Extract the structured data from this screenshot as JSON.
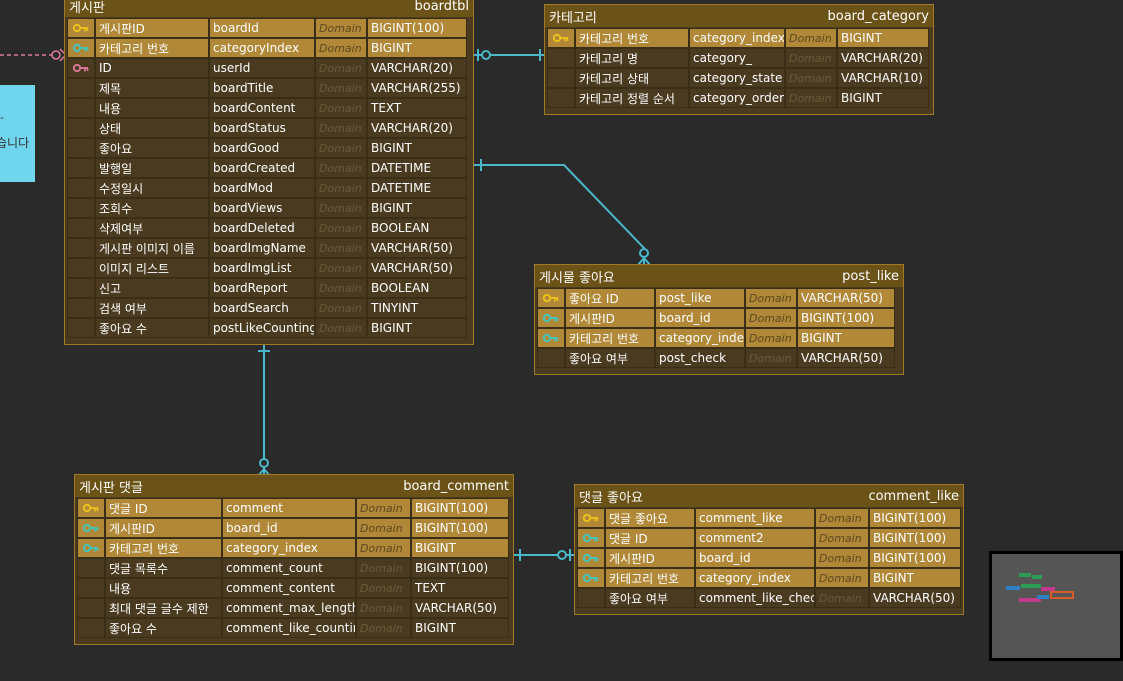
{
  "note": {
    "text_top": "-",
    "text_mid": "습니다"
  },
  "tables": {
    "boardtbl": {
      "title": "게시판",
      "name": "boardtbl",
      "rows": [
        {
          "label": "게시판ID",
          "column": "boardId",
          "domain": "Domain",
          "type": "BIGINT(100)",
          "key": "pk"
        },
        {
          "label": "카테고리 번호",
          "column": "categoryIndex",
          "domain": "Domain",
          "type": "BIGINT",
          "key": "pfk"
        },
        {
          "label": "ID",
          "column": "userId",
          "domain": "Domain",
          "type": "VARCHAR(20)",
          "key": "fk"
        },
        {
          "label": "제목",
          "column": "boardTitle",
          "domain": "Domain",
          "type": "VARCHAR(255)",
          "key": ""
        },
        {
          "label": "내용",
          "column": "boardContent",
          "domain": "Domain",
          "type": "TEXT",
          "key": ""
        },
        {
          "label": "상태",
          "column": "boardStatus",
          "domain": "Domain",
          "type": "VARCHAR(20)",
          "key": ""
        },
        {
          "label": "좋아요",
          "column": "boardGood",
          "domain": "Domain",
          "type": "BIGINT",
          "key": ""
        },
        {
          "label": "발행일",
          "column": "boardCreated",
          "domain": "Domain",
          "type": "DATETIME",
          "key": ""
        },
        {
          "label": "수정일시",
          "column": "boardMod",
          "domain": "Domain",
          "type": "DATETIME",
          "key": ""
        },
        {
          "label": "조회수",
          "column": "boardViews",
          "domain": "Domain",
          "type": "BIGINT",
          "key": ""
        },
        {
          "label": "삭제여부",
          "column": "boardDeleted",
          "domain": "Domain",
          "type": "BOOLEAN",
          "key": ""
        },
        {
          "label": "게시판 이미지 이름",
          "column": "boardImgName",
          "domain": "Domain",
          "type": "VARCHAR(50)",
          "key": ""
        },
        {
          "label": "이미지 리스트",
          "column": "boardImgList",
          "domain": "Domain",
          "type": "VARCHAR(50)",
          "key": ""
        },
        {
          "label": "신고",
          "column": "boardReport",
          "domain": "Domain",
          "type": "BOOLEAN",
          "key": ""
        },
        {
          "label": "검색 여부",
          "column": "boardSearch",
          "domain": "Domain",
          "type": "TINYINT",
          "key": ""
        },
        {
          "label": "좋아요 수",
          "column": "postLikeCounting",
          "domain": "Domain",
          "type": "BIGINT",
          "key": ""
        }
      ]
    },
    "board_category": {
      "title": "카테고리",
      "name": "board_category",
      "rows": [
        {
          "label": "카테고리 번호",
          "column": "category_index",
          "domain": "Domain",
          "type": "BIGINT",
          "key": "pk"
        },
        {
          "label": "카테고리 명",
          "column": "category_",
          "domain": "Domain",
          "type": "VARCHAR(20)",
          "key": ""
        },
        {
          "label": "카테고리 상태",
          "column": "category_state",
          "domain": "Domain",
          "type": "VARCHAR(10)",
          "key": ""
        },
        {
          "label": "카테고리 정렬 순서",
          "column": "category_order",
          "domain": "Domain",
          "type": "BIGINT",
          "key": ""
        }
      ]
    },
    "post_like": {
      "title": "게시물 좋아요",
      "name": "post_like",
      "rows": [
        {
          "label": "좋아요 ID",
          "column": "post_like",
          "domain": "Domain",
          "type": "VARCHAR(50)",
          "key": "pk"
        },
        {
          "label": "게시판ID",
          "column": "board_id",
          "domain": "Domain",
          "type": "BIGINT(100)",
          "key": "pfk"
        },
        {
          "label": "카테고리 번호",
          "column": "category_index",
          "domain": "Domain",
          "type": "BIGINT",
          "key": "pfk"
        },
        {
          "label": "좋아요 여부",
          "column": "post_check",
          "domain": "Domain",
          "type": "VARCHAR(50)",
          "key": ""
        }
      ]
    },
    "board_comment": {
      "title": "게시판 댓글",
      "name": "board_comment",
      "rows": [
        {
          "label": "댓글 ID",
          "column": "comment",
          "domain": "Domain",
          "type": "BIGINT(100)",
          "key": "pk"
        },
        {
          "label": "게시판ID",
          "column": "board_id",
          "domain": "Domain",
          "type": "BIGINT(100)",
          "key": "pfk"
        },
        {
          "label": "카테고리 번호",
          "column": "category_index",
          "domain": "Domain",
          "type": "BIGINT",
          "key": "pfk"
        },
        {
          "label": "댓글 목록수",
          "column": "comment_count",
          "domain": "Domain",
          "type": "BIGINT(100)",
          "key": ""
        },
        {
          "label": "내용",
          "column": "comment_content",
          "domain": "Domain",
          "type": "TEXT",
          "key": ""
        },
        {
          "label": "최대 댓글 글수 제한",
          "column": "comment_max_length",
          "domain": "Domain",
          "type": "VARCHAR(50)",
          "key": ""
        },
        {
          "label": "좋아요 수",
          "column": "comment_like_counting",
          "domain": "Domain",
          "type": "BIGINT",
          "key": ""
        }
      ]
    },
    "comment_like": {
      "title": "댓글 좋아요",
      "name": "comment_like",
      "rows": [
        {
          "label": "댓글 좋아요",
          "column": "comment_like",
          "domain": "Domain",
          "type": "BIGINT(100)",
          "key": "pk"
        },
        {
          "label": "댓글 ID",
          "column": "comment2",
          "domain": "Domain",
          "type": "BIGINT(100)",
          "key": "pfk"
        },
        {
          "label": "게시판ID",
          "column": "board_id",
          "domain": "Domain",
          "type": "BIGINT(100)",
          "key": "pfk"
        },
        {
          "label": "카테고리 번호",
          "column": "category_index",
          "domain": "Domain",
          "type": "BIGINT",
          "key": "pfk"
        },
        {
          "label": "좋아요 여부",
          "column": "comment_like_check",
          "domain": "Domain",
          "type": "VARCHAR(50)",
          "key": ""
        }
      ]
    }
  },
  "colors": {
    "pk_key": "#f0c419",
    "pfk_key": "#3ec8c0",
    "fk_key": "#e07a9a",
    "line": "#4ab8c8"
  }
}
